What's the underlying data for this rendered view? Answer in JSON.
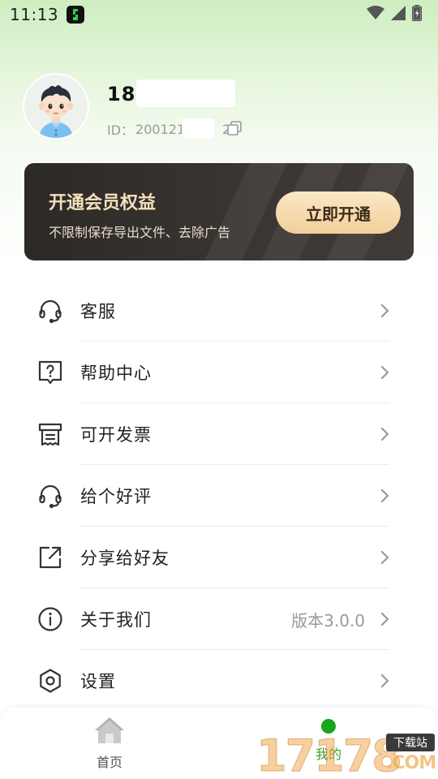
{
  "status_bar": {
    "time": "11:13"
  },
  "profile": {
    "phone": "181",
    "id_label": "ID：",
    "id_prefix": "200121",
    "id_suffix": "2"
  },
  "vip_card": {
    "title": "开通会员权益",
    "subtitle": "不限制保存导出文件、去除广告",
    "button_label": "立即开通"
  },
  "menu": {
    "items": [
      {
        "label": "客服",
        "icon": "headset-icon",
        "extra": ""
      },
      {
        "label": "帮助中心",
        "icon": "help-icon",
        "extra": ""
      },
      {
        "label": "可开发票",
        "icon": "invoice-icon",
        "extra": ""
      },
      {
        "label": "给个好评",
        "icon": "headset-icon",
        "extra": ""
      },
      {
        "label": "分享给好友",
        "icon": "share-icon",
        "extra": ""
      },
      {
        "label": "关于我们",
        "icon": "info-icon",
        "extra": "版本3.0.0"
      },
      {
        "label": "设置",
        "icon": "settings-icon",
        "extra": ""
      }
    ]
  },
  "bottom_nav": {
    "home_label": "首页",
    "mine_label": "我的"
  },
  "watermark": {
    "digits": "17178",
    "badge": "下载站",
    "domain": ".COM"
  },
  "colors": {
    "accent_green": "#16a51c",
    "vip_gold": "#f6dfbd",
    "vip_button": "#f2cf9b"
  }
}
